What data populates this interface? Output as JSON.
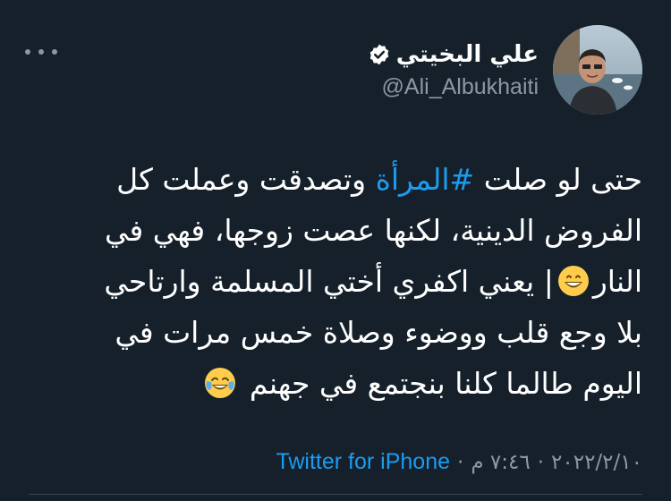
{
  "author": {
    "display_name": "علي البخيتي",
    "handle": "@Ali_Albukhaiti",
    "verified": true
  },
  "tweet": {
    "line1_before_hashtag": "حتى لو صلت ",
    "hashtag": "#المرأة",
    "line1_after_hashtag": " وتصدقت وعملت كل",
    "line2": "الفروض الدينية، لكنها عصت زوجها، فهي في",
    "line3_part1": "النار",
    "line3_part2": "| يعني اكفري أختي المسلمة وارتاحي",
    "line4": "بلا وجع قلب ووضوء وصلاة خمس مرات في",
    "line5": "اليوم طالما كلنا بنجتمع في جهنم"
  },
  "emojis": {
    "first": "grinning-face-with-smiling-eyes",
    "second": "face-with-tears-of-joy"
  },
  "meta": {
    "date": "٢٠٢٢/٢/١٠",
    "time": "٧:٤٦ م",
    "separator": "·",
    "source": "Twitter for iPhone"
  },
  "colors": {
    "background": "#15202b",
    "text": "#ffffff",
    "secondary": "#8b98a5",
    "accent": "#1d9bf0"
  }
}
